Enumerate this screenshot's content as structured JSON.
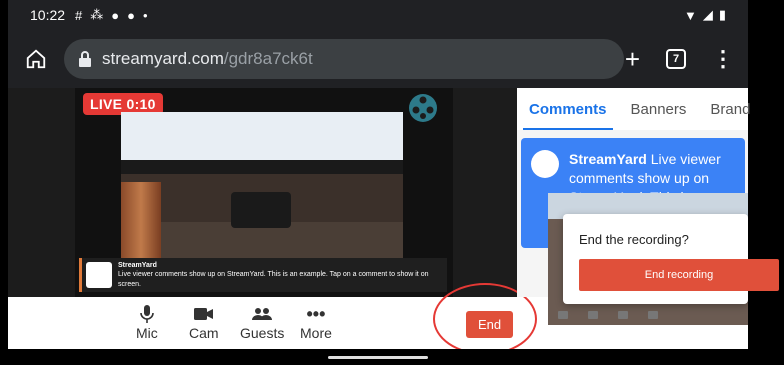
{
  "status_bar": {
    "time": "10:22"
  },
  "browser": {
    "url_host": "streamyard.com",
    "url_path": "/gdr8a7ck6t",
    "tab_count": "7"
  },
  "stage": {
    "live_label": "LIVE 0:10",
    "caption": {
      "name": "StreamYard",
      "text": "Live viewer comments show up on StreamYard. This is an example. Tap on a comment to show it on screen."
    }
  },
  "controls": [
    {
      "label": "Mic",
      "icon": "mic-icon"
    },
    {
      "label": "Cam",
      "icon": "camera-icon"
    },
    {
      "label": "Guests",
      "icon": "guests-icon"
    },
    {
      "label": "More",
      "icon": "more-icon"
    }
  ],
  "end_button": "End",
  "panel": {
    "tabs": [
      "Comments",
      "Banners",
      "Brand"
    ],
    "active_tab": "Comments",
    "comment": {
      "name": "StreamYard",
      "text": "Live viewer comments show up on StreamYard. This is an"
    }
  },
  "modal": {
    "title": "End the recording?",
    "button": "End recording"
  },
  "colors": {
    "accent_blue": "#1a73e8",
    "end_red": "#e0503a",
    "live_red": "#e53935",
    "comment_blue": "#3b82f6"
  }
}
